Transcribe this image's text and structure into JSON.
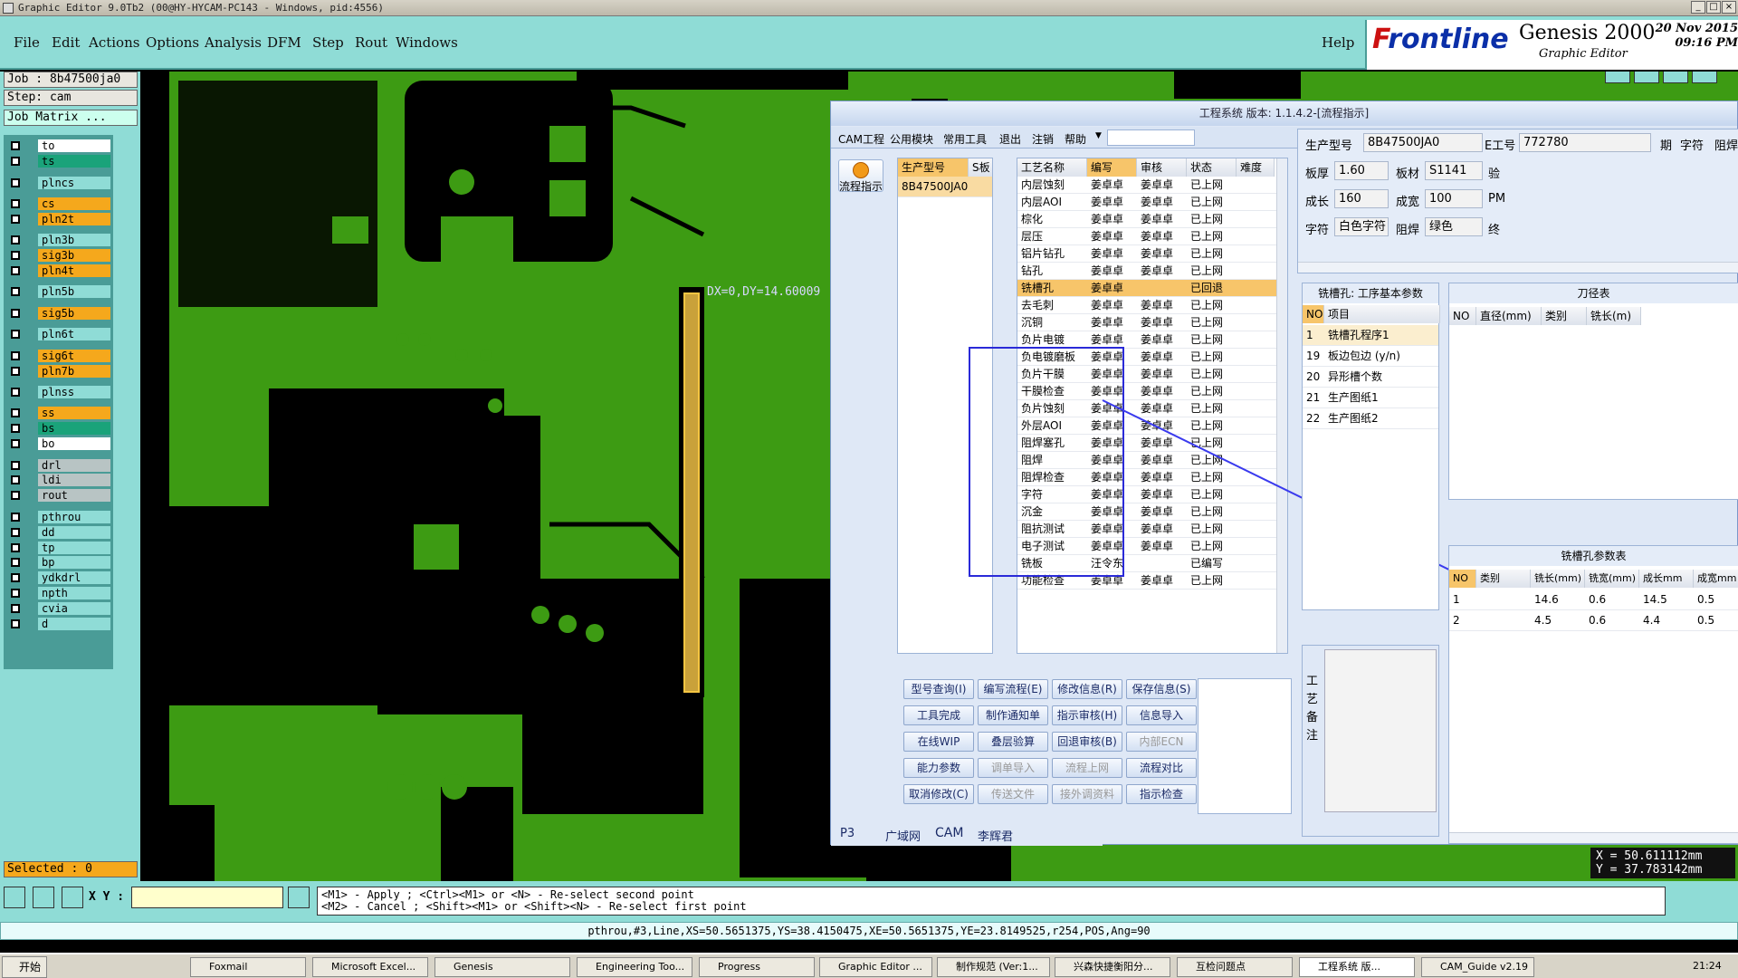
{
  "window": {
    "title": "Graphic Editor 9.0Tb2 (00@HY-HYCAM-PC143 - Windows, pid:4556)"
  },
  "menu": [
    "File",
    "Edit",
    "Actions",
    "Options",
    "Analysis",
    "DFM",
    "Step",
    "Rout",
    "Windows"
  ],
  "help": "Help",
  "brand": {
    "logo_f": "F",
    "logo_rest": "rontline",
    "product": "Genesis 2000",
    "sub": "Graphic Editor",
    "date": "20 Nov 2015",
    "time": "09:16 PM"
  },
  "job": {
    "job": "Job : 8b47500ja0",
    "step": "Step: cam",
    "matrix": "Job Matrix ..."
  },
  "layers": [
    {
      "name": "to",
      "bg": "#ffffff",
      "fg": "#000"
    },
    {
      "name": "ts",
      "bg": "#1aa37a",
      "fg": "#000"
    },
    {
      "name": "plncs",
      "bg": "#8fdcd6",
      "fg": "#000"
    },
    {
      "name": "cs",
      "bg": "#f5a81c",
      "fg": "#000"
    },
    {
      "name": "pln2t",
      "bg": "#f5a81c",
      "fg": "#000"
    },
    {
      "name": "pln3b",
      "bg": "#8fdcd6",
      "fg": "#000"
    },
    {
      "name": "sig3b",
      "bg": "#f5a81c",
      "fg": "#000"
    },
    {
      "name": "pln4t",
      "bg": "#f5a81c",
      "fg": "#000"
    },
    {
      "name": "pln5b",
      "bg": "#8fdcd6",
      "fg": "#000"
    },
    {
      "name": "sig5b",
      "bg": "#f5a81c",
      "fg": "#000"
    },
    {
      "name": "pln6t",
      "bg": "#8fdcd6",
      "fg": "#000"
    },
    {
      "name": "sig6t",
      "bg": "#f5a81c",
      "fg": "#000"
    },
    {
      "name": "pln7b",
      "bg": "#f5a81c",
      "fg": "#000"
    },
    {
      "name": "plnss",
      "bg": "#8fdcd6",
      "fg": "#000"
    },
    {
      "name": "ss",
      "bg": "#f5a81c",
      "fg": "#000"
    },
    {
      "name": "bs",
      "bg": "#1aa37a",
      "fg": "#000"
    },
    {
      "name": "bo",
      "bg": "#ffffff",
      "fg": "#000"
    },
    {
      "name": "drl",
      "bg": "#b8c4c4",
      "fg": "#000"
    },
    {
      "name": "ldi",
      "bg": "#b8c4c4",
      "fg": "#000"
    },
    {
      "name": "rout",
      "bg": "#b8c4c4",
      "fg": "#000"
    },
    {
      "name": "pthrou",
      "bg": "#8fdcd6",
      "fg": "#000"
    },
    {
      "name": "dd",
      "bg": "#8fdcd6",
      "fg": "#000"
    },
    {
      "name": "tp",
      "bg": "#8fdcd6",
      "fg": "#000"
    },
    {
      "name": "bp",
      "bg": "#8fdcd6",
      "fg": "#000"
    },
    {
      "name": "ydkdrl",
      "bg": "#8fdcd6",
      "fg": "#000"
    },
    {
      "name": "npth",
      "bg": "#8fdcd6",
      "fg": "#000"
    },
    {
      "name": "cvia",
      "bg": "#8fdcd6",
      "fg": "#000"
    },
    {
      "name": "d",
      "bg": "#8fdcd6",
      "fg": "#000"
    }
  ],
  "selected": "Selected : 0",
  "measure": "DX=0,DY=14.60009",
  "coords": {
    "x": "X = 50.611112mm",
    "y": "Y = 37.783142mm"
  },
  "xy_label": "X Y :",
  "hints": [
    "<M1> - Apply ; <Ctrl><M1> or <N> - Re-select second point",
    "<M2> - Cancel ; <Shift><M1> or <Shift><N> - Re-select first point"
  ],
  "status": "pthrou,#3,Line,XS=50.5651375,YS=38.4150475,XE=50.5651375,YE=23.8149525,r254,POS,Ang=90",
  "dialog": {
    "title": "工程系统 版本: 1.1.4.2-[流程指示]",
    "menu": [
      "CAM工程",
      "公用模块",
      "常用工具",
      "退出",
      "注销",
      "帮助"
    ],
    "flow_btn": "流程指示",
    "model_cols": [
      "生产型号",
      "S板"
    ],
    "model_rows": [
      "8B47500JA0"
    ],
    "proc_cols": [
      "工艺名称",
      "编写",
      "审核",
      "状态",
      "难度"
    ],
    "proc_rows": [
      [
        "内层蚀刻",
        "姜卓卓",
        "姜卓卓",
        "已上网"
      ],
      [
        "内层AOI",
        "姜卓卓",
        "姜卓卓",
        "已上网"
      ],
      [
        "棕化",
        "姜卓卓",
        "姜卓卓",
        "已上网"
      ],
      [
        "层压",
        "姜卓卓",
        "姜卓卓",
        "已上网"
      ],
      [
        "铝片钻孔",
        "姜卓卓",
        "姜卓卓",
        "已上网"
      ],
      [
        "钻孔",
        "姜卓卓",
        "姜卓卓",
        "已上网"
      ],
      [
        "铣槽孔",
        "姜卓卓",
        "",
        "已回退"
      ],
      [
        "去毛刺",
        "姜卓卓",
        "姜卓卓",
        "已上网"
      ],
      [
        "沉铜",
        "姜卓卓",
        "姜卓卓",
        "已上网"
      ],
      [
        "负片电镀",
        "姜卓卓",
        "姜卓卓",
        "已上网"
      ],
      [
        "负电镀磨板",
        "姜卓卓",
        "姜卓卓",
        "已上网"
      ],
      [
        "负片干膜",
        "姜卓卓",
        "姜卓卓",
        "已上网"
      ],
      [
        "干膜检查",
        "姜卓卓",
        "姜卓卓",
        "已上网"
      ],
      [
        "负片蚀刻",
        "姜卓卓",
        "姜卓卓",
        "已上网"
      ],
      [
        "外层AOI",
        "姜卓卓",
        "姜卓卓",
        "已上网"
      ],
      [
        "阻焊塞孔",
        "姜卓卓",
        "姜卓卓",
        "已上网"
      ],
      [
        "阻焊",
        "姜卓卓",
        "姜卓卓",
        "已上网"
      ],
      [
        "阻焊检查",
        "姜卓卓",
        "姜卓卓",
        "已上网"
      ],
      [
        "字符",
        "姜卓卓",
        "姜卓卓",
        "已上网"
      ],
      [
        "沉金",
        "姜卓卓",
        "姜卓卓",
        "已上网"
      ],
      [
        "阻抗测试",
        "姜卓卓",
        "姜卓卓",
        "已上网"
      ],
      [
        "电子测试",
        "姜卓卓",
        "姜卓卓",
        "已上网"
      ],
      [
        "铣板",
        "汪令东",
        "",
        "已编写"
      ],
      [
        "功能检查",
        "姜卓卓",
        "姜卓卓",
        "已上网"
      ]
    ],
    "buttons": [
      [
        "型号查询(I)",
        "编写流程(E)",
        "修改信息(R)",
        "保存信息(S)"
      ],
      [
        "工具完成",
        "制作通知单",
        "指示审核(H)",
        "信息导入"
      ],
      [
        "在线WIP",
        "叠层验算",
        "回退审核(B)",
        "内部ECN"
      ],
      [
        "能力参数",
        "调单导入",
        "流程上网",
        "流程对比"
      ],
      [
        "取消修改(C)",
        "传送文件",
        "接外调资料",
        "指示检查"
      ]
    ],
    "info": {
      "model_label": "生产型号",
      "model": "8B47500JA0",
      "eng_label": "E工号",
      "eng": "772780",
      "extra1": "期",
      "extra2": "字符",
      "extra3": "阻焊",
      "thick_label": "板厚",
      "thick": "1.60",
      "mat_label": "板材",
      "mat": "S1141",
      "verify": "验",
      "len_label": "成长",
      "len": "160",
      "wid_label": "成宽",
      "wid": "100",
      "pm": "PM",
      "char_label": "字符",
      "char": "白色字符",
      "mask_label": "阻焊",
      "mask": "绿色",
      "end": "终"
    },
    "param_title": "铣槽孔: 工序基本参数",
    "param_cols": [
      "NO",
      "项目"
    ],
    "param_rows": [
      [
        "1",
        "铣槽孔程序1"
      ],
      [
        "19",
        "板边包边 (y/n)"
      ],
      [
        "20",
        "异形槽个数"
      ],
      [
        "21",
        "生产图纸1"
      ],
      [
        "22",
        "生产图纸2"
      ]
    ],
    "tool_title": "刀径表",
    "tool_cols": [
      "NO",
      "直径(mm)",
      "类别",
      "铣长(m)"
    ],
    "slot_title": "铣槽孔参数表",
    "slot_cols": [
      "NO",
      "类别",
      "铣长(mm)",
      "铣宽(mm)",
      "成长mm",
      "成宽mm"
    ],
    "slot_rows": [
      [
        "1",
        "",
        "14.6",
        "0.6",
        "14.5",
        "0.5"
      ],
      [
        "2",
        "",
        "4.5",
        "0.6",
        "4.4",
        "0.5"
      ]
    ],
    "remark_label": "工艺备注",
    "bottom_tabs": [
      "P3",
      "广域网",
      "CAM",
      "李辉君"
    ]
  },
  "taskbar": {
    "start": "开始",
    "tasks": [
      "Foxmail",
      "Microsoft Excel...",
      "Genesis",
      "Engineering Too...",
      "Progress",
      "Graphic Editor ...",
      "制作规范 (Ver:1...",
      "兴森快捷衡阳分...",
      "互检问题点",
      "工程系统 版...",
      "CAM_Guide v2.19"
    ],
    "clock": "21:24"
  }
}
